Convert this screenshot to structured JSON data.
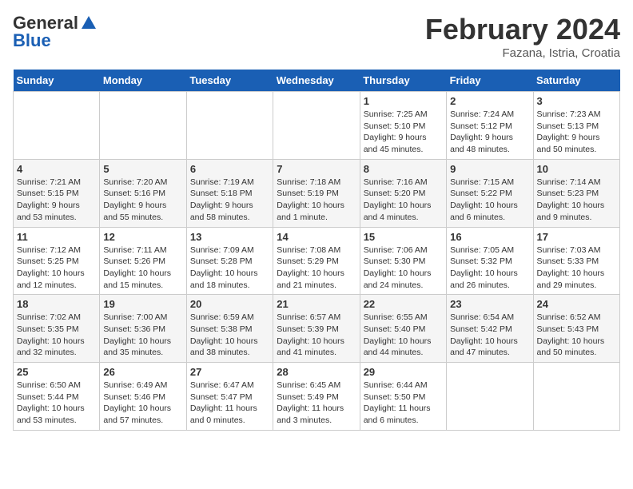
{
  "header": {
    "logo_general": "General",
    "logo_blue": "Blue",
    "month_title": "February 2024",
    "location": "Fazana, Istria, Croatia"
  },
  "calendar": {
    "days_of_week": [
      "Sunday",
      "Monday",
      "Tuesday",
      "Wednesday",
      "Thursday",
      "Friday",
      "Saturday"
    ],
    "weeks": [
      [
        {
          "day": "",
          "info": ""
        },
        {
          "day": "",
          "info": ""
        },
        {
          "day": "",
          "info": ""
        },
        {
          "day": "",
          "info": ""
        },
        {
          "day": "1",
          "info": "Sunrise: 7:25 AM\nSunset: 5:10 PM\nDaylight: 9 hours\nand 45 minutes."
        },
        {
          "day": "2",
          "info": "Sunrise: 7:24 AM\nSunset: 5:12 PM\nDaylight: 9 hours\nand 48 minutes."
        },
        {
          "day": "3",
          "info": "Sunrise: 7:23 AM\nSunset: 5:13 PM\nDaylight: 9 hours\nand 50 minutes."
        }
      ],
      [
        {
          "day": "4",
          "info": "Sunrise: 7:21 AM\nSunset: 5:15 PM\nDaylight: 9 hours\nand 53 minutes."
        },
        {
          "day": "5",
          "info": "Sunrise: 7:20 AM\nSunset: 5:16 PM\nDaylight: 9 hours\nand 55 minutes."
        },
        {
          "day": "6",
          "info": "Sunrise: 7:19 AM\nSunset: 5:18 PM\nDaylight: 9 hours\nand 58 minutes."
        },
        {
          "day": "7",
          "info": "Sunrise: 7:18 AM\nSunset: 5:19 PM\nDaylight: 10 hours\nand 1 minute."
        },
        {
          "day": "8",
          "info": "Sunrise: 7:16 AM\nSunset: 5:20 PM\nDaylight: 10 hours\nand 4 minutes."
        },
        {
          "day": "9",
          "info": "Sunrise: 7:15 AM\nSunset: 5:22 PM\nDaylight: 10 hours\nand 6 minutes."
        },
        {
          "day": "10",
          "info": "Sunrise: 7:14 AM\nSunset: 5:23 PM\nDaylight: 10 hours\nand 9 minutes."
        }
      ],
      [
        {
          "day": "11",
          "info": "Sunrise: 7:12 AM\nSunset: 5:25 PM\nDaylight: 10 hours\nand 12 minutes."
        },
        {
          "day": "12",
          "info": "Sunrise: 7:11 AM\nSunset: 5:26 PM\nDaylight: 10 hours\nand 15 minutes."
        },
        {
          "day": "13",
          "info": "Sunrise: 7:09 AM\nSunset: 5:28 PM\nDaylight: 10 hours\nand 18 minutes."
        },
        {
          "day": "14",
          "info": "Sunrise: 7:08 AM\nSunset: 5:29 PM\nDaylight: 10 hours\nand 21 minutes."
        },
        {
          "day": "15",
          "info": "Sunrise: 7:06 AM\nSunset: 5:30 PM\nDaylight: 10 hours\nand 24 minutes."
        },
        {
          "day": "16",
          "info": "Sunrise: 7:05 AM\nSunset: 5:32 PM\nDaylight: 10 hours\nand 26 minutes."
        },
        {
          "day": "17",
          "info": "Sunrise: 7:03 AM\nSunset: 5:33 PM\nDaylight: 10 hours\nand 29 minutes."
        }
      ],
      [
        {
          "day": "18",
          "info": "Sunrise: 7:02 AM\nSunset: 5:35 PM\nDaylight: 10 hours\nand 32 minutes."
        },
        {
          "day": "19",
          "info": "Sunrise: 7:00 AM\nSunset: 5:36 PM\nDaylight: 10 hours\nand 35 minutes."
        },
        {
          "day": "20",
          "info": "Sunrise: 6:59 AM\nSunset: 5:38 PM\nDaylight: 10 hours\nand 38 minutes."
        },
        {
          "day": "21",
          "info": "Sunrise: 6:57 AM\nSunset: 5:39 PM\nDaylight: 10 hours\nand 41 minutes."
        },
        {
          "day": "22",
          "info": "Sunrise: 6:55 AM\nSunset: 5:40 PM\nDaylight: 10 hours\nand 44 minutes."
        },
        {
          "day": "23",
          "info": "Sunrise: 6:54 AM\nSunset: 5:42 PM\nDaylight: 10 hours\nand 47 minutes."
        },
        {
          "day": "24",
          "info": "Sunrise: 6:52 AM\nSunset: 5:43 PM\nDaylight: 10 hours\nand 50 minutes."
        }
      ],
      [
        {
          "day": "25",
          "info": "Sunrise: 6:50 AM\nSunset: 5:44 PM\nDaylight: 10 hours\nand 53 minutes."
        },
        {
          "day": "26",
          "info": "Sunrise: 6:49 AM\nSunset: 5:46 PM\nDaylight: 10 hours\nand 57 minutes."
        },
        {
          "day": "27",
          "info": "Sunrise: 6:47 AM\nSunset: 5:47 PM\nDaylight: 11 hours\nand 0 minutes."
        },
        {
          "day": "28",
          "info": "Sunrise: 6:45 AM\nSunset: 5:49 PM\nDaylight: 11 hours\nand 3 minutes."
        },
        {
          "day": "29",
          "info": "Sunrise: 6:44 AM\nSunset: 5:50 PM\nDaylight: 11 hours\nand 6 minutes."
        },
        {
          "day": "",
          "info": ""
        },
        {
          "day": "",
          "info": ""
        }
      ]
    ]
  }
}
